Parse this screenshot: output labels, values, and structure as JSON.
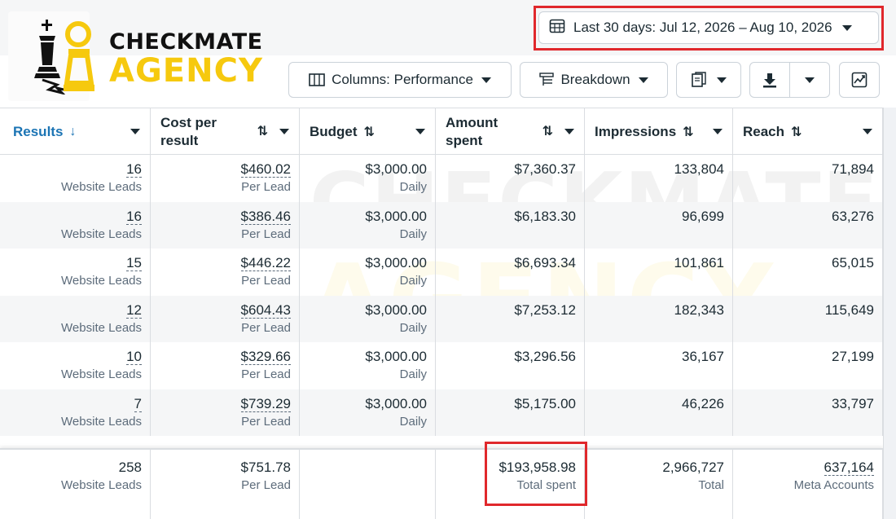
{
  "brand": {
    "line1": "CHECKMATE",
    "line2": "AGENCY",
    "colors": {
      "dark": "#111111",
      "yellow": "#f6c90e"
    }
  },
  "toolbar": {
    "date_range": "Last 30 days: Jul 12, 2026 – Aug 10, 2026",
    "columns_label": "Columns: Performance",
    "breakdown_label": "Breakdown",
    "icons": [
      "calendar-icon",
      "columns-icon",
      "breakdown-icon",
      "reports-icon",
      "download-icon",
      "chart-icon"
    ]
  },
  "table": {
    "headers": [
      {
        "key": "results",
        "line1": "Results",
        "line2": "",
        "sort": "↓"
      },
      {
        "key": "cost",
        "line1": "Cost per",
        "line2": "result",
        "sort": "⇅"
      },
      {
        "key": "budget",
        "line1": "Budget",
        "line2": "",
        "sort": "⇅"
      },
      {
        "key": "amount",
        "line1": "Amount",
        "line2": "spent",
        "sort": "⇅"
      },
      {
        "key": "impressions",
        "line1": "Impressions",
        "line2": "",
        "sort": "⇅"
      },
      {
        "key": "reach",
        "line1": "Reach",
        "line2": "",
        "sort": "⇅"
      }
    ],
    "rows": [
      {
        "results": "16",
        "results_sub": "Website Leads",
        "cost": "$460.02",
        "cost_sub": "Per Lead",
        "budget": "$3,000.00",
        "budget_sub": "Daily",
        "amount": "$7,360.37",
        "impressions": "133,804",
        "reach": "71,894"
      },
      {
        "results": "16",
        "results_sub": "Website Leads",
        "cost": "$386.46",
        "cost_sub": "Per Lead",
        "budget": "$3,000.00",
        "budget_sub": "Daily",
        "amount": "$6,183.30",
        "impressions": "96,699",
        "reach": "63,276"
      },
      {
        "results": "15",
        "results_sub": "Website Leads",
        "cost": "$446.22",
        "cost_sub": "Per Lead",
        "budget": "$3,000.00",
        "budget_sub": "Daily",
        "amount": "$6,693.34",
        "impressions": "101,861",
        "reach": "65,015"
      },
      {
        "results": "12",
        "results_sub": "Website Leads",
        "cost": "$604.43",
        "cost_sub": "Per Lead",
        "budget": "$3,000.00",
        "budget_sub": "Daily",
        "amount": "$7,253.12",
        "impressions": "182,343",
        "reach": "115,649"
      },
      {
        "results": "10",
        "results_sub": "Website Leads",
        "cost": "$329.66",
        "cost_sub": "Per Lead",
        "budget": "$3,000.00",
        "budget_sub": "Daily",
        "amount": "$3,296.56",
        "impressions": "36,167",
        "reach": "27,199"
      },
      {
        "results": "7",
        "results_sub": "Website Leads",
        "cost": "$739.29",
        "cost_sub": "Per Lead",
        "budget": "$3,000.00",
        "budget_sub": "Daily",
        "amount": "$5,175.00",
        "impressions": "46,226",
        "reach": "33,797"
      }
    ],
    "totals": {
      "results": "258",
      "results_sub": "Website Leads",
      "cost": "$751.78",
      "cost_sub": "Per Lead",
      "amount": "$193,958.98",
      "amount_sub": "Total spent",
      "impressions": "2,966,727",
      "impressions_sub": "Total",
      "reach": "637,164",
      "reach_sub": "Meta Accounts"
    }
  },
  "highlight_color": "#e0282c"
}
